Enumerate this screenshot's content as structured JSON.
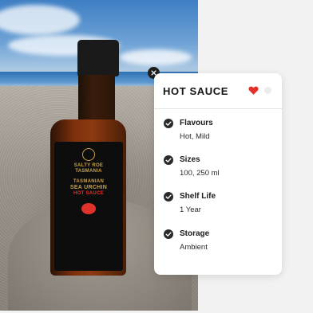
{
  "card": {
    "title": "HOT SAUCE",
    "icons": {
      "favorite": "heart-icon",
      "close": "close-icon",
      "bullet": "check-circle-icon"
    },
    "accent_color": "#e0322b",
    "specs": [
      {
        "title": "Flavours",
        "value": "Hot, Mild"
      },
      {
        "title": "Sizes",
        "value": "100, 250 ml"
      },
      {
        "title": "Shelf Life",
        "value": "1 Year"
      },
      {
        "title": "Storage",
        "value": "Ambient"
      }
    ]
  },
  "product_label": {
    "brand_line1": "SALTY ROE",
    "brand_line2": "TASMANIA",
    "name_line1": "TASMANIAN",
    "name_line2": "SEA URCHIN",
    "name_line3": "HOT SAUCE"
  }
}
